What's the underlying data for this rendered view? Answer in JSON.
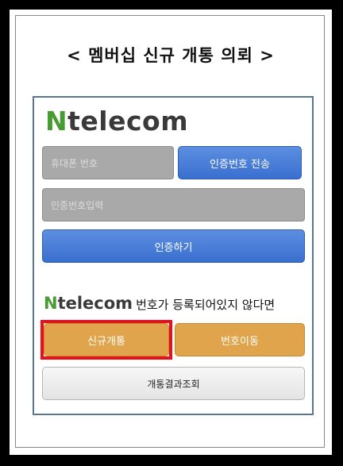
{
  "title": "< 멤버십 신규 개통 의뢰 >",
  "logo": {
    "n": "N",
    "rest": "telecom"
  },
  "phone_field": {
    "placeholder": "휴대폰 번호"
  },
  "send_code_button": {
    "label": "인증번호 전송"
  },
  "code_field": {
    "placeholder": "인증번호입력"
  },
  "verify_button": {
    "label": "인증하기"
  },
  "notice": {
    "text": "번호가 등록되어있지 않다면"
  },
  "new_open_button": {
    "label": "신규개통"
  },
  "port_button": {
    "label": "번호이동"
  },
  "result_button": {
    "label": "개통결과조회"
  },
  "colors": {
    "accent_blue": "#3a6fd0",
    "accent_orange": "#e0a54c",
    "logo_green": "#4a9a34",
    "highlight": "#e8101a"
  }
}
